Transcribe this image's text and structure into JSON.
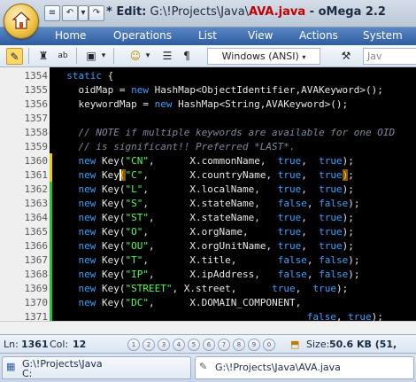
{
  "window": {
    "title_prefix": "* Edit:",
    "title_path": " G:\\!Projects\\Java\\",
    "title_file": "AVA.java",
    "title_app": " - oMega 2.2"
  },
  "menu": [
    "Home",
    "Operations",
    "List",
    "View",
    "Actions",
    "System"
  ],
  "toolbar": {
    "encoding": "Windows (ANSI)",
    "right_field": "Jav"
  },
  "editor": {
    "lines": [
      {
        "n": "1354",
        "mark": "",
        "code": [
          {
            "t": "  ",
            "c": "plain"
          },
          {
            "t": "static",
            "c": "kw"
          },
          {
            "t": " {",
            "c": "plain"
          }
        ]
      },
      {
        "n": "1355",
        "mark": "",
        "code": [
          {
            "t": "    oidMap = ",
            "c": "plain"
          },
          {
            "t": "new",
            "c": "kw"
          },
          {
            "t": " HashMap<ObjectIdentifier,AVAKeyword>();",
            "c": "plain"
          }
        ]
      },
      {
        "n": "1356",
        "mark": "",
        "code": [
          {
            "t": "    keywordMap = ",
            "c": "plain"
          },
          {
            "t": "new",
            "c": "kw"
          },
          {
            "t": " HashMap<String,AVAKeyword>();",
            "c": "plain"
          }
        ]
      },
      {
        "n": "1357",
        "mark": "",
        "code": []
      },
      {
        "n": "1358",
        "mark": "",
        "code": [
          {
            "t": "    // NOTE if multiple keywords are available for one OID",
            "c": "cm"
          }
        ]
      },
      {
        "n": "1359",
        "mark": "",
        "code": [
          {
            "t": "    // is significant!! Preferred *LAST*.",
            "c": "cm"
          }
        ]
      },
      {
        "n": "1360",
        "mark": "yellow",
        "code": [
          {
            "t": "    ",
            "c": "plain"
          },
          {
            "t": "new",
            "c": "kw"
          },
          {
            "t": " Key(",
            "c": "plain"
          },
          {
            "t": "\"CN\"",
            "c": "str"
          },
          {
            "t": ",      X.commonName,  ",
            "c": "plain"
          },
          {
            "t": "true",
            "c": "kw"
          },
          {
            "t": ",  ",
            "c": "plain"
          },
          {
            "t": "true",
            "c": "kw"
          },
          {
            "t": ");",
            "c": "plain"
          }
        ]
      },
      {
        "n": "1361",
        "mark": "yellow",
        "code": [
          {
            "t": "    ",
            "c": "plain"
          },
          {
            "t": "new",
            "c": "kw"
          },
          {
            "t": " Key",
            "c": "plain"
          },
          {
            "t": "(",
            "c": "brk"
          },
          {
            "t": "\"C\"",
            "c": "str"
          },
          {
            "t": ",       X.countryName, ",
            "c": "plain"
          },
          {
            "t": "true",
            "c": "kw"
          },
          {
            "t": ",  ",
            "c": "plain"
          },
          {
            "t": "true",
            "c": "kw"
          },
          {
            "t": ")",
            "c": "brk"
          },
          {
            "t": ";",
            "c": "plain"
          }
        ]
      },
      {
        "n": "1362",
        "mark": "green",
        "code": [
          {
            "t": "    ",
            "c": "plain"
          },
          {
            "t": "new",
            "c": "kw"
          },
          {
            "t": " Key(",
            "c": "plain"
          },
          {
            "t": "\"L\"",
            "c": "str"
          },
          {
            "t": ",       X.localName,   ",
            "c": "plain"
          },
          {
            "t": "true",
            "c": "kw"
          },
          {
            "t": ",  ",
            "c": "plain"
          },
          {
            "t": "true",
            "c": "kw"
          },
          {
            "t": ");",
            "c": "plain"
          }
        ]
      },
      {
        "n": "1363",
        "mark": "green",
        "code": [
          {
            "t": "    ",
            "c": "plain"
          },
          {
            "t": "new",
            "c": "kw"
          },
          {
            "t": " Key(",
            "c": "plain"
          },
          {
            "t": "\"S\"",
            "c": "str"
          },
          {
            "t": ",       X.stateName,   ",
            "c": "plain"
          },
          {
            "t": "false",
            "c": "kw"
          },
          {
            "t": ", ",
            "c": "plain"
          },
          {
            "t": "false",
            "c": "kw"
          },
          {
            "t": ");",
            "c": "plain"
          }
        ]
      },
      {
        "n": "1364",
        "mark": "green",
        "code": [
          {
            "t": "    ",
            "c": "plain"
          },
          {
            "t": "new",
            "c": "kw"
          },
          {
            "t": " Key(",
            "c": "plain"
          },
          {
            "t": "\"ST\"",
            "c": "str"
          },
          {
            "t": ",      X.stateName,   ",
            "c": "plain"
          },
          {
            "t": "true",
            "c": "kw"
          },
          {
            "t": ",  ",
            "c": "plain"
          },
          {
            "t": "true",
            "c": "kw"
          },
          {
            "t": ");",
            "c": "plain"
          }
        ]
      },
      {
        "n": "1365",
        "mark": "green",
        "code": [
          {
            "t": "    ",
            "c": "plain"
          },
          {
            "t": "new",
            "c": "kw"
          },
          {
            "t": " Key(",
            "c": "plain"
          },
          {
            "t": "\"O\"",
            "c": "str"
          },
          {
            "t": ",       X.orgName,     ",
            "c": "plain"
          },
          {
            "t": "true",
            "c": "kw"
          },
          {
            "t": ",  ",
            "c": "plain"
          },
          {
            "t": "true",
            "c": "kw"
          },
          {
            "t": ");",
            "c": "plain"
          }
        ]
      },
      {
        "n": "1366",
        "mark": "green",
        "code": [
          {
            "t": "    ",
            "c": "plain"
          },
          {
            "t": "new",
            "c": "kw"
          },
          {
            "t": " Key(",
            "c": "plain"
          },
          {
            "t": "\"OU\"",
            "c": "str"
          },
          {
            "t": ",      X.orgUnitName, ",
            "c": "plain"
          },
          {
            "t": "true",
            "c": "kw"
          },
          {
            "t": ",  ",
            "c": "plain"
          },
          {
            "t": "true",
            "c": "kw"
          },
          {
            "t": ");",
            "c": "plain"
          }
        ]
      },
      {
        "n": "1367",
        "mark": "green",
        "code": [
          {
            "t": "    ",
            "c": "plain"
          },
          {
            "t": "new",
            "c": "kw"
          },
          {
            "t": " Key(",
            "c": "plain"
          },
          {
            "t": "\"T\"",
            "c": "str"
          },
          {
            "t": ",       X.title,       ",
            "c": "plain"
          },
          {
            "t": "false",
            "c": "kw"
          },
          {
            "t": ", ",
            "c": "plain"
          },
          {
            "t": "false",
            "c": "kw"
          },
          {
            "t": ");",
            "c": "plain"
          }
        ]
      },
      {
        "n": "1368",
        "mark": "green",
        "code": [
          {
            "t": "    ",
            "c": "plain"
          },
          {
            "t": "new",
            "c": "kw"
          },
          {
            "t": " Key(",
            "c": "plain"
          },
          {
            "t": "\"IP\"",
            "c": "str"
          },
          {
            "t": ",      X.ipAddress,   ",
            "c": "plain"
          },
          {
            "t": "false",
            "c": "kw"
          },
          {
            "t": ", ",
            "c": "plain"
          },
          {
            "t": "false",
            "c": "kw"
          },
          {
            "t": ");",
            "c": "plain"
          }
        ]
      },
      {
        "n": "1369",
        "mark": "green",
        "code": [
          {
            "t": "    ",
            "c": "plain"
          },
          {
            "t": "new",
            "c": "kw"
          },
          {
            "t": " Key(",
            "c": "plain"
          },
          {
            "t": "\"STREET\"",
            "c": "str"
          },
          {
            "t": ", X.street,      ",
            "c": "plain"
          },
          {
            "t": "true",
            "c": "kw"
          },
          {
            "t": ",  ",
            "c": "plain"
          },
          {
            "t": "true",
            "c": "kw"
          },
          {
            "t": ");",
            "c": "plain"
          }
        ]
      },
      {
        "n": "1370",
        "mark": "green",
        "code": [
          {
            "t": "    ",
            "c": "plain"
          },
          {
            "t": "new",
            "c": "kw"
          },
          {
            "t": " Key(",
            "c": "plain"
          },
          {
            "t": "\"DC\"",
            "c": "str"
          },
          {
            "t": ",      X.DOMAIN_COMPONENT,",
            "c": "plain"
          }
        ]
      },
      {
        "n": "1371",
        "mark": "green",
        "code": [
          {
            "t": "                                           ",
            "c": "plain"
          },
          {
            "t": "false",
            "c": "kw"
          },
          {
            "t": ", ",
            "c": "plain"
          },
          {
            "t": "true",
            "c": "kw"
          },
          {
            "t": ");",
            "c": "plain"
          }
        ]
      }
    ]
  },
  "status": {
    "ln_label": "Ln:",
    "ln_value": "1361",
    "col_label": "Col:",
    "col_value": "12",
    "circles": [
      "1",
      "2",
      "3",
      "4",
      "5",
      "6",
      "7",
      "8",
      "9",
      "0"
    ],
    "size_label": "Size:",
    "size_value": "50.6 KB (51,"
  },
  "tabs": [
    {
      "line1": "G:\\!Projects\\Java",
      "line2": "C:"
    },
    {
      "line1": "G:\\!Projects\\Java\\AVA.java",
      "line2": ""
    }
  ],
  "colors": {
    "editor_bg": "#000000",
    "keyword": "#3aa0ff",
    "string": "#4cff4c",
    "comment": "#7d8aa0",
    "mark_yellow": "#e8d000",
    "mark_green": "#2fbf2f"
  }
}
